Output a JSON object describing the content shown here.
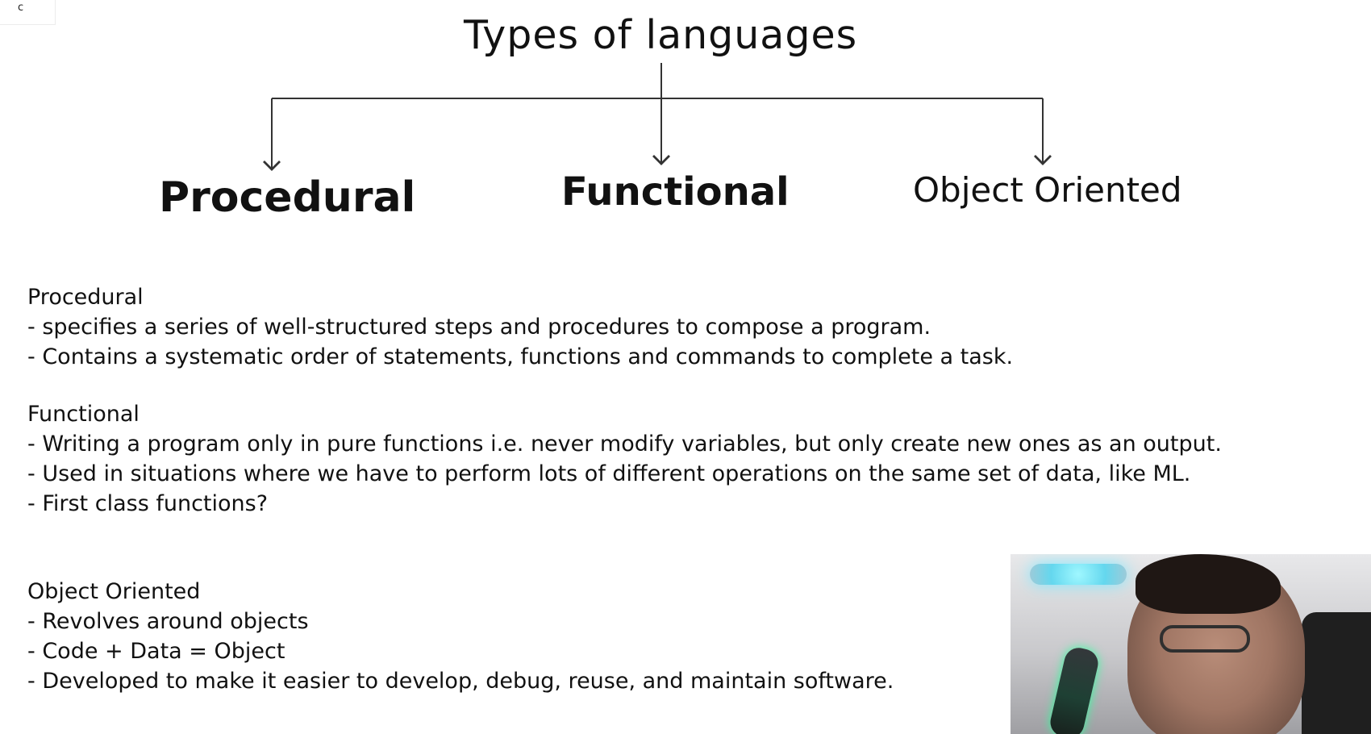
{
  "top_left_glyph": "c",
  "title": "Types of languages",
  "branches": [
    "Procedural",
    "Functional",
    "Object Oriented"
  ],
  "sections": {
    "procedural": {
      "heading": "Procedural",
      "bullets": [
        "- specifies a series of well-structured steps and procedures to compose a program.",
        "- Contains a systematic order of statements, functions and commands to complete a task."
      ]
    },
    "functional": {
      "heading": "Functional",
      "bullets": [
        "- Writing a program only in pure functions i.e. never modify variables, but only create new ones as an output.",
        "- Used in situations where we have to perform lots of different operations on the same set of data, like ML.",
        "- First class functions?"
      ]
    },
    "object_oriented": {
      "heading": "Object Oriented",
      "bullets": [
        "- Revolves around objects",
        "- Code + Data = Object",
        "- Developed to make it easier to develop, debug, reuse, and maintain software."
      ]
    }
  },
  "webcam": {
    "lamp_color": "#7ee8ff",
    "mic_glow_color": "#2fff9d"
  }
}
